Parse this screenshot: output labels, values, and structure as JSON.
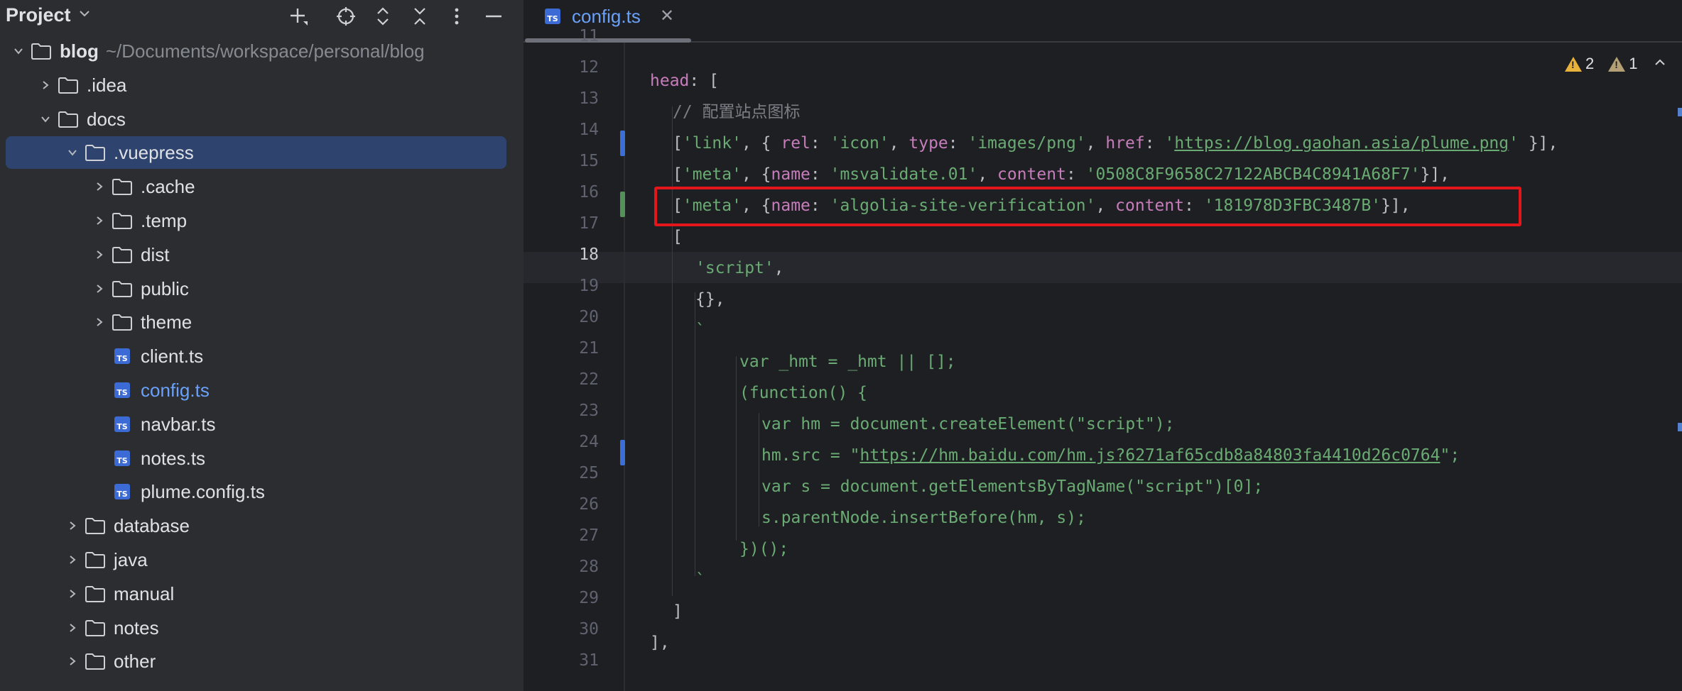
{
  "project": {
    "title": "Project",
    "tree": [
      {
        "label": "blog",
        "path": "~/Documents/workspace/personal/blog",
        "type": "folder",
        "expanded": true
      },
      {
        "label": ".idea",
        "type": "folder",
        "expanded": false
      },
      {
        "label": "docs",
        "type": "folder",
        "expanded": true
      },
      {
        "label": ".vuepress",
        "type": "folder",
        "expanded": true,
        "selected": true
      },
      {
        "label": ".cache",
        "type": "folder",
        "expanded": false
      },
      {
        "label": ".temp",
        "type": "folder",
        "expanded": false
      },
      {
        "label": "dist",
        "type": "folder",
        "expanded": false
      },
      {
        "label": "public",
        "type": "folder",
        "expanded": false
      },
      {
        "label": "theme",
        "type": "folder",
        "expanded": false
      },
      {
        "label": "client.ts",
        "type": "ts-file"
      },
      {
        "label": "config.ts",
        "type": "ts-file",
        "active": true
      },
      {
        "label": "navbar.ts",
        "type": "ts-file"
      },
      {
        "label": "notes.ts",
        "type": "ts-file"
      },
      {
        "label": "plume.config.ts",
        "type": "ts-file"
      },
      {
        "label": "database",
        "type": "folder",
        "expanded": false
      },
      {
        "label": "java",
        "type": "folder",
        "expanded": false
      },
      {
        "label": "manual",
        "type": "folder",
        "expanded": false
      },
      {
        "label": "notes",
        "type": "folder",
        "expanded": false
      },
      {
        "label": "other",
        "type": "folder",
        "expanded": false
      }
    ]
  },
  "editor": {
    "tab": {
      "icon_text": "TS",
      "label": "config.ts",
      "close": "✕"
    },
    "inspections": {
      "warnings": "2",
      "weak_warnings": "1"
    },
    "line_numbers": [
      "11",
      "12",
      "13",
      "14",
      "15",
      "16",
      "17",
      "18",
      "19",
      "20",
      "21",
      "22",
      "23",
      "24",
      "25",
      "26",
      "27",
      "28",
      "29",
      "30",
      "31"
    ],
    "current_line": "18",
    "lines": {
      "l12": {
        "head": "head",
        "rest": ": ["
      },
      "l13": "// 配置站点图标",
      "l14": {
        "a": "[",
        "b": "'link'",
        "c": ", { ",
        "d": "rel",
        "e": ": ",
        "f": "'icon'",
        "g": ", ",
        "h": "type",
        "i": ": ",
        "j": "'images/png'",
        "k": ", ",
        "l": "href",
        "m": ": ",
        "n": "'",
        "o": "https://blog.gaohan.asia/plume.png",
        "p": "'",
        "q": " }],"
      },
      "l15": {
        "a": "[",
        "b": "'meta'",
        "c": ", {",
        "d": "name",
        "e": ": ",
        "f": "'msvalidate.01'",
        "g": ", ",
        "h": "content",
        "i": ": ",
        "j": "'0508C8F9658C27122ABCB4C8941A68F7'",
        "k": "}],"
      },
      "l16": {
        "a": "[",
        "b": "'meta'",
        "c": ", {",
        "d": "name",
        "e": ": ",
        "f": "'algolia-site-verification'",
        "g": ", ",
        "h": "content",
        "i": ": ",
        "j": "'181978D3FBC3487B'",
        "k": "}],"
      },
      "l17": "[",
      "l18": {
        "a": "'script'",
        "b": ","
      },
      "l19": "{},",
      "l20": "`",
      "l21": "var _hmt = _hmt || [];",
      "l22": "(function() {",
      "l23": "var hm = document.createElement(\"script\");",
      "l24": {
        "a": "hm.src = \"",
        "b": "https://hm.baidu.com/hm.js?6271af65cdb8a84803fa4410d26c0764",
        "c": "\";"
      },
      "l25": "var s = document.getElementsByTagName(\"script\")[0];",
      "l26": "s.parentNode.insertBefore(hm, s);",
      "l27": "})();",
      "l28": "`",
      "l29": "]",
      "l30": "],"
    }
  },
  "colors": {
    "keyword": "#c77dbb",
    "string": "#6aab73",
    "comment": "#7a7e85",
    "highlight_box": "#e2161b",
    "selection": "#2e436e",
    "accent_blue": "#6aa0f8"
  }
}
